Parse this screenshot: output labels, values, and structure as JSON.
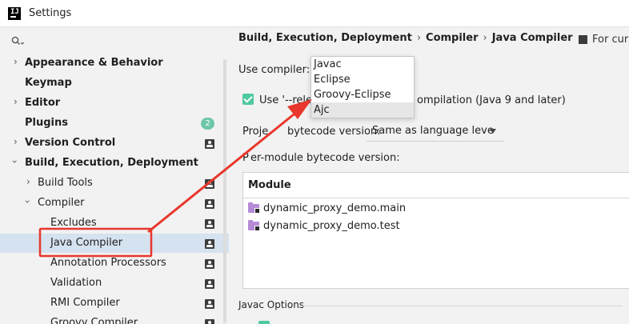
{
  "window": {
    "title": "Settings"
  },
  "sidebar": {
    "items": [
      {
        "label": "Appearance & Behavior"
      },
      {
        "label": "Keymap"
      },
      {
        "label": "Editor"
      },
      {
        "label": "Plugins",
        "badge": "2"
      },
      {
        "label": "Version Control"
      },
      {
        "label": "Build, Execution, Deployment"
      },
      {
        "label": "Build Tools"
      },
      {
        "label": "Compiler"
      },
      {
        "label": "Excludes"
      },
      {
        "label": "Java Compiler"
      },
      {
        "label": "Annotation Processors"
      },
      {
        "label": "Validation"
      },
      {
        "label": "RMI Compiler"
      },
      {
        "label": "Groovy Compiler"
      }
    ]
  },
  "main": {
    "breadcrumb": [
      "Build, Execution, Deployment",
      "Compiler",
      "Java Compiler"
    ],
    "for_current_project": "For curr",
    "use_compiler_label": "Use compiler:",
    "compiler_options": [
      "Javac",
      "Eclipse",
      "Groovy-Eclipse",
      "Ajc"
    ],
    "highlighted_option": "Ajc",
    "release_checkbox_prefix": "Use '--relea",
    "release_checkbox_suffix": "ompilation (Java 9 and later)",
    "bytecode_label_prefix": "Proje",
    "bytecode_label_suffix": "bytecode version:",
    "bytecode_value": "Same as language leve",
    "per_module_label_prefix": "P",
    "per_module_label_suffix": "er-module bytecode version:",
    "module_column": "Module",
    "modules": [
      "dynamic_proxy_demo.main",
      "dynamic_proxy_demo.test"
    ],
    "javac_options_title": "Javac Options"
  },
  "colors": {
    "selection": "#d5e2ef",
    "checkbox": "#4ec9a0",
    "badge": "#6fc6a8",
    "annotation": "#e8372c",
    "folder": "#b58ad6"
  }
}
